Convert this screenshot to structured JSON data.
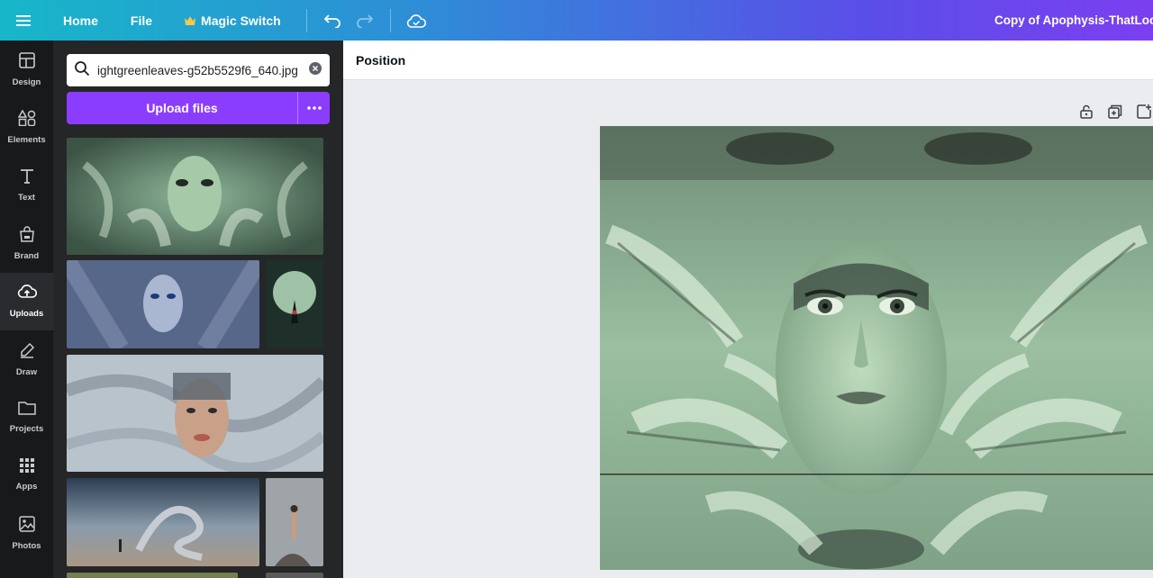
{
  "topbar": {
    "home": "Home",
    "file": "File",
    "magic_switch": "Magic Switch",
    "doc_title": "Copy of Apophysis-ThatLook"
  },
  "rail": {
    "items": [
      {
        "label": "Design",
        "icon": "layout-icon"
      },
      {
        "label": "Elements",
        "icon": "shapes-icon"
      },
      {
        "label": "Text",
        "icon": "text-icon"
      },
      {
        "label": "Brand",
        "icon": "brand-icon"
      },
      {
        "label": "Uploads",
        "icon": "cloud-upload-icon"
      },
      {
        "label": "Draw",
        "icon": "pen-icon"
      },
      {
        "label": "Projects",
        "icon": "folder-icon"
      },
      {
        "label": "Apps",
        "icon": "grid-icon"
      },
      {
        "label": "Photos",
        "icon": "image-icon"
      }
    ]
  },
  "panel": {
    "search_value": "ightgreenleaves-g52b5529f6_640.jpg",
    "upload_label": "Upload files"
  },
  "editor": {
    "toolbar_label": "Position"
  },
  "colors": {
    "accent": "#8b3dff",
    "rail_bg": "#18191b",
    "panel_bg": "#252627"
  }
}
